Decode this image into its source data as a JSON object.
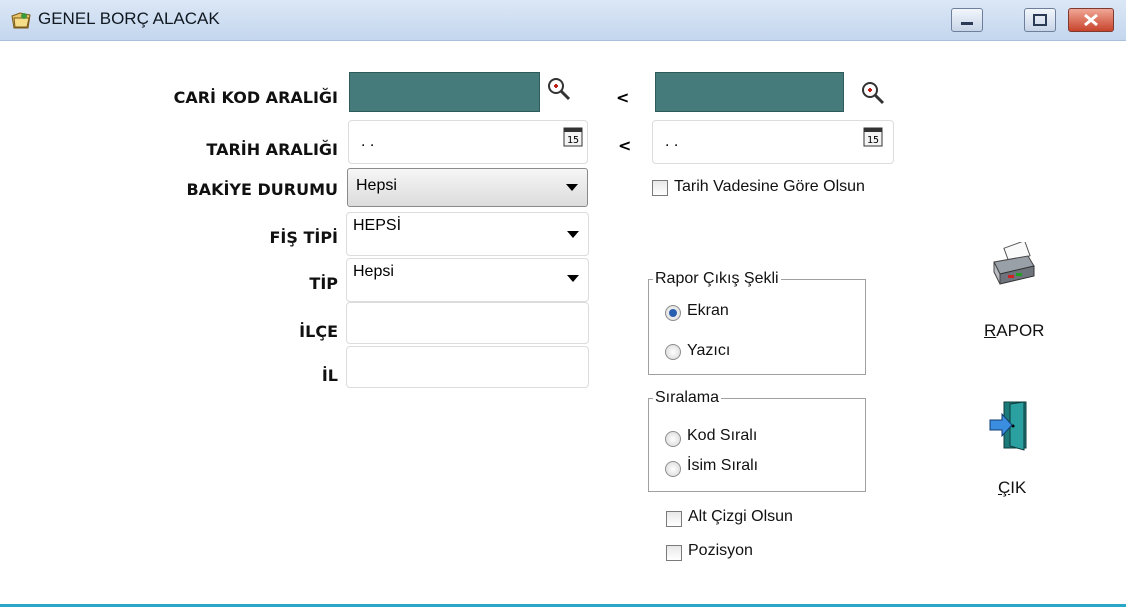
{
  "window": {
    "title": "GENEL BORÇ ALACAK"
  },
  "form": {
    "cari_kod_label": "CARİ KOD ARALIĞI",
    "tarih_label": "TARİH ARALIĞI",
    "bakiye_label": "BAKİYE DURUMU",
    "fis_tipi_label": "FİŞ TİPİ",
    "tip_label": "TİP",
    "ilce_label": "İLÇE",
    "il_label": "İL",
    "range_separator": "<",
    "tarih_from_value": ". .",
    "tarih_to_value": ". .",
    "calendar_day": "15",
    "bakiye_value": "Hepsi",
    "fis_tipi_value": "HEPSİ",
    "tip_value": "Hepsi",
    "ilce_value": "",
    "il_value": ""
  },
  "options": {
    "tarih_vade_label": "Tarih Vadesine Göre Olsun",
    "alt_cizgi_label": "Alt Çizgi Olsun",
    "pozisyon_label": "Pozisyon"
  },
  "rapor_cikis": {
    "title": "Rapor Çıkış Şekli",
    "ekran_label": "Ekran",
    "yazici_label": "Yazıcı",
    "selected": "Ekran"
  },
  "siralama": {
    "title": "Sıralama",
    "kod_label": "Kod Sıralı",
    "isim_label": "İsim Sıralı"
  },
  "buttons": {
    "rapor_first": "R",
    "rapor_rest": "APOR",
    "cik_first": "Ç",
    "cik_rest": "IK"
  },
  "colors": {
    "cari_field": "#467b7b",
    "radio_selected": "#2a5fb0"
  }
}
